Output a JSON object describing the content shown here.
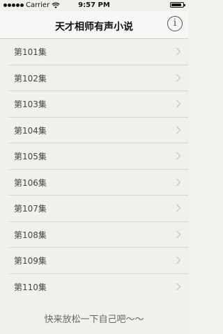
{
  "status_bar": {
    "carrier": "Carrier",
    "time": "9:57 PM",
    "battery_level": 0.85,
    "signal_icon": "signal-dots-icon",
    "wifi_icon": "wifi-icon",
    "battery_icon": "battery-icon"
  },
  "nav_bar": {
    "title": "天才相师有声小说",
    "info_label": "i",
    "info_icon": "info-icon"
  },
  "episodes": [
    {
      "label": "第101集"
    },
    {
      "label": "第102集"
    },
    {
      "label": "第103集"
    },
    {
      "label": "第104集"
    },
    {
      "label": "第105集"
    },
    {
      "label": "第106集"
    },
    {
      "label": "第107集"
    },
    {
      "label": "第108集"
    },
    {
      "label": "第109集"
    },
    {
      "label": "第110集"
    }
  ],
  "footer": {
    "text": "快来放松一下自己吧～～"
  },
  "colors": {
    "background": "#f1f0eb",
    "separator": "#d6d4cf",
    "chevron": "#c7c7cc",
    "text": "#444444"
  }
}
